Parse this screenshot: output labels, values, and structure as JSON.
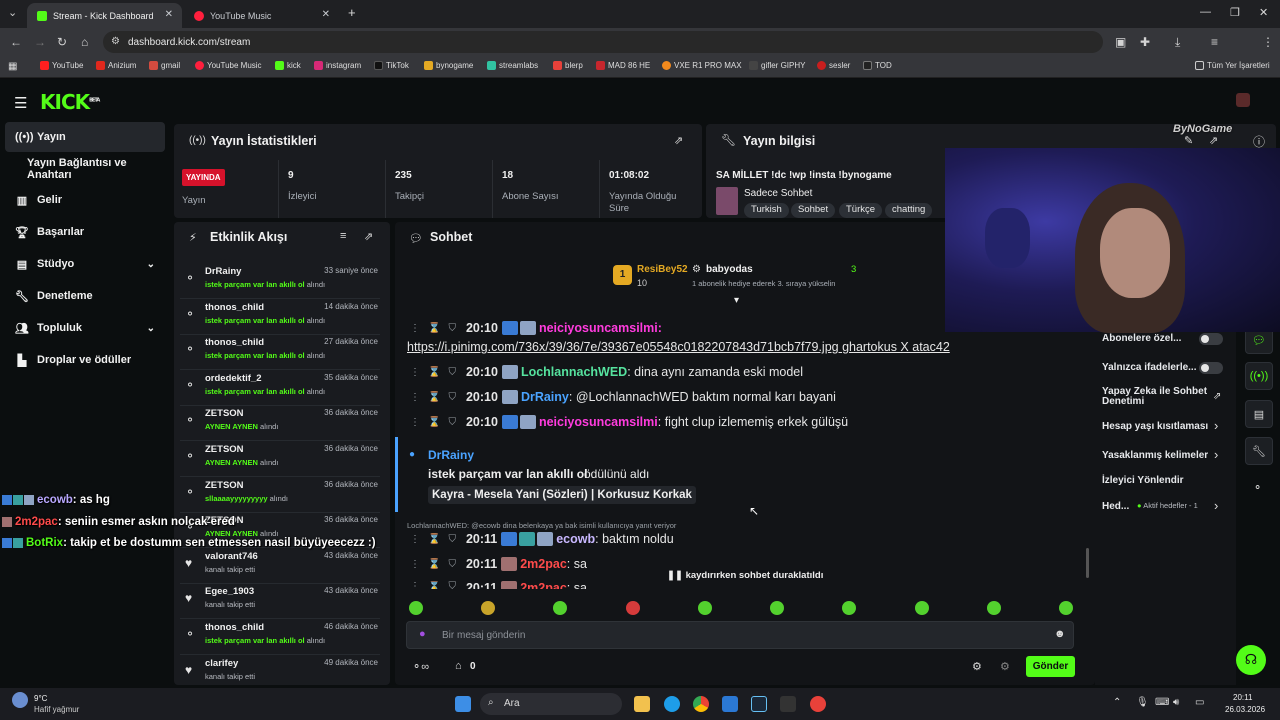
{
  "browser": {
    "tabs": [
      {
        "title": "Stream - Kick Dashboard"
      },
      {
        "title": "YouTube Music"
      }
    ],
    "new_tab": "+",
    "url": "dashboard.kick.com/stream",
    "bookmarks": [
      "YouTube",
      "Anizium",
      "gmail",
      "YouTube Music",
      "kick",
      "instagram",
      "TikTok",
      "bynogame",
      "streamlabs",
      "blerp",
      "MAD 86 HE",
      "VXE R1 PRO MAX",
      "gifler GIPHY",
      "sesler",
      "TOD"
    ],
    "all_bookmarks": "Tüm Yer İşaretleri"
  },
  "sidebar": {
    "logo": "KICK",
    "logo_sup": "BETA",
    "items": [
      {
        "label": "Yayın",
        "icon": "broadcast-icon"
      },
      {
        "label": "Yayın Bağlantısı ve Anahtarı",
        "icon": ""
      },
      {
        "label": "Gelir",
        "icon": "chart-icon"
      },
      {
        "label": "Başarılar",
        "icon": "trophy-icon"
      },
      {
        "label": "Stüdyo",
        "icon": "studio-icon"
      },
      {
        "label": "Denetleme",
        "icon": "wrench-icon"
      },
      {
        "label": "Topluluk",
        "icon": "people-icon"
      },
      {
        "label": "Droplar ve ödüller",
        "icon": "drops-icon"
      }
    ]
  },
  "stats": {
    "title": "Yayın İstatistikleri",
    "live_badge": "YAYINDA",
    "live_label": "Yayın",
    "items": [
      {
        "value": "9",
        "label": "İzleyici"
      },
      {
        "value": "235",
        "label": "Takipçi"
      },
      {
        "value": "18",
        "label": "Abone Sayısı"
      },
      {
        "value": "01:08:02",
        "label": "Yayında Olduğu Süre"
      }
    ]
  },
  "stream_info": {
    "title": "Yayın bilgisi",
    "stream_title": "SA MİLLET !dc !wp !insta !bynogame",
    "category": "Sadece Sohbet",
    "tags": [
      "Turkish",
      "Sohbet",
      "Türkçe",
      "chatting"
    ]
  },
  "activity": {
    "title": "Etkinlik Akışı",
    "rows": [
      {
        "name": "DrRainy",
        "time": "33 saniye önce",
        "reward": "istek parçam var lan akıllı ol",
        "suffix": "alındı"
      },
      {
        "name": "thonos_child",
        "time": "14 dakika önce",
        "reward": "istek parçam var lan akıllı ol",
        "suffix": "alındı"
      },
      {
        "name": "thonos_child",
        "time": "27 dakika önce",
        "reward": "istek parçam var lan akıllı ol",
        "suffix": "alındı"
      },
      {
        "name": "ordedektif_2",
        "time": "35 dakika önce",
        "reward": "istek parçam var lan akıllı ol",
        "suffix": "alındı"
      },
      {
        "name": "ZETSON",
        "time": "36 dakika önce",
        "reward": "AYNEN AYNEN",
        "suffix": "alındı"
      },
      {
        "name": "ZETSON",
        "time": "36 dakika önce",
        "reward": "AYNEN AYNEN",
        "suffix": "alındı"
      },
      {
        "name": "ZETSON",
        "time": "36 dakika önce",
        "reward": "sllaaaayyyyyyyyy",
        "suffix": "alındı"
      },
      {
        "name": "ZETSON",
        "time": "36 dakika önce",
        "reward": "AYNEN AYNEN",
        "suffix": "alındı"
      },
      {
        "name": "valorant746",
        "time": "43 dakika önce",
        "reward": "",
        "suffix": "kanalı takip etti"
      },
      {
        "name": "Egee_1903",
        "time": "43 dakika önce",
        "reward": "",
        "suffix": "kanalı takip etti"
      },
      {
        "name": "thonos_child",
        "time": "46 dakika önce",
        "reward": "istek parçam var lan akıllı ol",
        "suffix": "alındı"
      },
      {
        "name": "clarifey",
        "time": "49 dakika önce",
        "reward": "",
        "suffix": "kanalı takip etti"
      }
    ]
  },
  "chat": {
    "title": "Sohbet",
    "top_gifter": {
      "rank": "1",
      "name": "ResiBey52",
      "count": "10"
    },
    "gift_user": {
      "name": "babyodas",
      "count": "3",
      "text": "1 abonelik hediye ederek 3. sıraya yükselin"
    },
    "messages": [
      {
        "time": "20:10",
        "user": "neiciyosuncamsilmi",
        "color": "#ff3cde",
        "text": ""
      },
      {
        "time": "20:10",
        "user": "LochlannachWED",
        "color": "#56e39f",
        "text": ": dina aynı zamanda eski model"
      },
      {
        "time": "20:10",
        "user": "DrRainy",
        "color": "#4aa3ff",
        "text": ": @LochlannachWED baktım normal karı bayani"
      },
      {
        "time": "20:10",
        "user": "neiciyosuncamsilmi",
        "color": "#ff3cde",
        "text": ": fight clup izlememiş erkek gülüşü"
      },
      {
        "time": "20:11",
        "user": "ecowb",
        "color": "#c9b8ff",
        "text": ": baktım noldu"
      },
      {
        "time": "20:11",
        "user": "2m2pac",
        "color": "#ff4b4b",
        "text": ": sa"
      },
      {
        "time": "20:11",
        "user": "2m2pac",
        "color": "#ff4b4b",
        "text": ": sa"
      }
    ],
    "link_line": "https://i.pinimg.com/736x/39/36/7e/39367e05548c0182207843d71bcb7f79.jpg ghartokus X atac42",
    "redeem": {
      "user": "DrRainy",
      "text": "istek parçam var lan akıllı ol",
      "suffix": "ödülünü aldı",
      "song": "Kayra - Mesela Yani (Sözleri) | Korkusuz Korkak"
    },
    "reply_line": "LochlannachWED: @ecowb dina belenkaya ya bak isimli kullanıcıya yanıt veriyor",
    "paused": "kaydırırken sohbet duraklatıldı",
    "input_placeholder": "Bir mesaj gönderin",
    "points": "0",
    "send": "Gönder"
  },
  "chat_settings": {
    "items": [
      {
        "label": "Abonelere özel..."
      },
      {
        "label": "Yalnızca ifadelerle..."
      },
      {
        "label": "Yapay Zeka ile Sohbet Denetimi"
      },
      {
        "label": "Hesap yaşı kısıtlaması"
      },
      {
        "label": "Yasaklanmış kelimeler"
      },
      {
        "label": "İzleyici Yönlendir"
      },
      {
        "label": "Hed..."
      }
    ],
    "active_goals": "Aktif hedefler - 1"
  },
  "overlay": {
    "watermark": "ByNoGame",
    "lines": [
      {
        "user": "ecowb",
        "color": "#b9a8ff",
        "text": ": as hg"
      },
      {
        "user": "2m2pac",
        "color": "#ff4b4b",
        "text": ": seniin esmer askın nolcak ered"
      },
      {
        "user": "BotRix",
        "color": "#53fc18",
        "text": ": takip et be dostumm sen etmessen nasil büyüyeecezz :)"
      }
    ]
  },
  "taskbar": {
    "weather_temp": "9°C",
    "weather_desc": "Hafif yağmur",
    "search": "Ara",
    "time": "20:11",
    "date": "26.03.2026"
  }
}
